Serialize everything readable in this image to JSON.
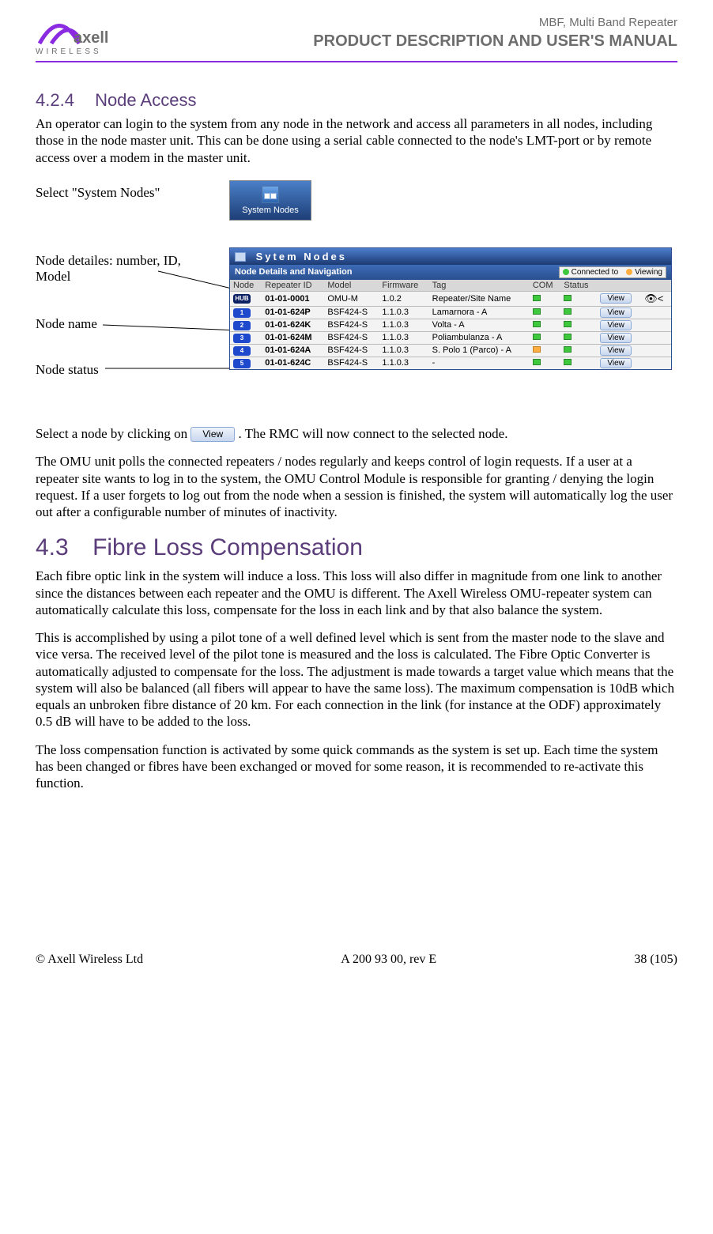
{
  "header": {
    "logo_brand": "axell",
    "logo_sub": "WIRELESS",
    "line1": "MBF, Multi Band Repeater",
    "line2": "PRODUCT DESCRIPTION AND USER'S MANUAL"
  },
  "section_424": {
    "number": "4.2.4",
    "title": "Node Access",
    "para1": "An operator can login to the system from any node in the network and access all parameters in all nodes, including those in the node master unit. This can be done using a serial cable connected to the node's LMT-port or by remote access over a modem in the master unit."
  },
  "callouts": {
    "select_sysnodes": "Select \"System Nodes\"",
    "node_details": "Node detailes: number, ID, Model",
    "node_name": "Node name",
    "node_status": "Node status"
  },
  "sysnodes_button_label": "System Nodes",
  "table_window": {
    "window_title": "Sytem  Nodes",
    "subtitle": "Node Details and Navigation",
    "legend_connected": "Connected to",
    "legend_viewing": "Viewing",
    "columns": [
      "Node",
      "Repeater ID",
      "Model",
      "Firmware",
      "Tag",
      "COM",
      "Status",
      "",
      ""
    ],
    "rows": [
      {
        "badge": "HUB",
        "badgeClass": "hub",
        "id": "01-01-0001",
        "model": "OMU-M",
        "fw": "1.0.2",
        "tag": "Repeater/Site Name",
        "com": "green",
        "view": "View",
        "eye": true
      },
      {
        "badge": "1",
        "badgeClass": "",
        "id": "01-01-624P",
        "model": "BSF424-S",
        "fw": "1.1.0.3",
        "tag": "Lamarnora - A",
        "com": "green",
        "view": "View",
        "eye": false
      },
      {
        "badge": "2",
        "badgeClass": "",
        "id": "01-01-624K",
        "model": "BSF424-S",
        "fw": "1.1.0.3",
        "tag": "Volta - A",
        "com": "green",
        "view": "View",
        "eye": false
      },
      {
        "badge": "3",
        "badgeClass": "",
        "id": "01-01-624M",
        "model": "BSF424-S",
        "fw": "1.1.0.3",
        "tag": "Poliambulanza - A",
        "com": "green",
        "view": "View",
        "eye": false
      },
      {
        "badge": "4",
        "badgeClass": "",
        "id": "01-01-624A",
        "model": "BSF424-S",
        "fw": "1.1.0.3",
        "tag": "S. Polo 1 (Parco) - A",
        "com": "orange",
        "view": "View",
        "eye": false
      },
      {
        "badge": "5",
        "badgeClass": "",
        "id": "01-01-624C",
        "model": "BSF424-S",
        "fw": "1.1.0.3",
        "tag": "-",
        "com": "green",
        "view": "View",
        "eye": false
      }
    ]
  },
  "para_after_table_prefix": "Select a node by clicking on ",
  "inline_view_label": "View",
  "para_after_table_suffix": ". The RMC will now connect to the selected node.",
  "para_omu": "The OMU unit polls the connected repeaters / nodes regularly and keeps control of login requests. If a user at a repeater site wants to log in to the system, the OMU Control Module is responsible for granting / denying the login request. If a user forgets to log out from the node when a session is finished, the system will automatically log the user out after a configurable number of minutes of inactivity.",
  "section_43": {
    "number": "4.3",
    "title": "Fibre Loss Compensation",
    "para1": "Each fibre optic link in the system will induce a loss. This loss will also differ in magnitude from one link to another since the distances between each repeater and the OMU is different. The Axell Wireless OMU-repeater system can automatically calculate this loss, compensate for the loss in each link and by that also balance the system.",
    "para2": "This is accomplished by using a pilot tone of a well defined level which is sent from the master node to the slave and vice versa. The received level of the pilot tone is measured and the loss is calculated. The Fibre Optic Converter is automatically adjusted to compensate for the loss. The adjustment is made towards a target value which means that the system will also be balanced (all fibers will appear to have the same loss). The maximum compensation is 10dB which equals an unbroken fibre distance of 20 km. For each connection in the link (for instance at the ODF) approximately 0.5 dB will have to be added to the loss.",
    "para3": "The loss compensation function is activated by some quick commands as the system is set up. Each time the system has been changed or fibres have been exchanged or moved for some reason, it is recommended to re-activate this function."
  },
  "footer": {
    "left": "© Axell Wireless Ltd",
    "center": "A 200 93 00, rev E",
    "right": "38 (105)"
  }
}
